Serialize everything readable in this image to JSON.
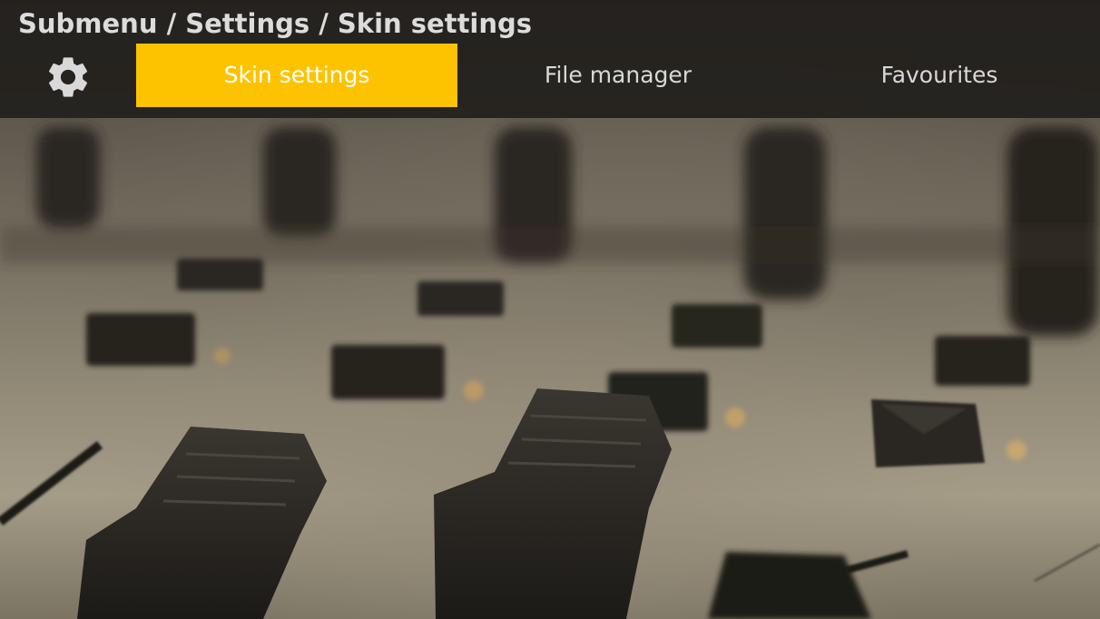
{
  "header": {
    "breadcrumb": "Submenu / Settings / Skin settings"
  },
  "tabs": [
    {
      "label": "Skin settings",
      "active": true
    },
    {
      "label": "File manager",
      "active": false
    },
    {
      "label": "Favourites",
      "active": false
    }
  ],
  "icons": {
    "settings": "gear-icon"
  },
  "colors": {
    "accent": "#fdc300",
    "header_bg": "#221f1c",
    "text": "#d8d8d8"
  }
}
